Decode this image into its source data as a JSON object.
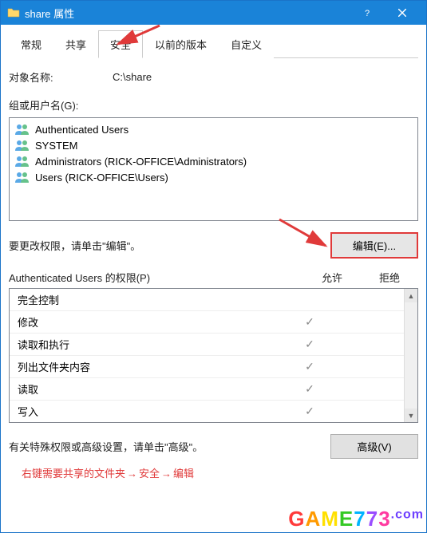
{
  "titlebar": {
    "title": "share 属性"
  },
  "tabs": [
    {
      "label": "常规",
      "active": false
    },
    {
      "label": "共享",
      "active": false
    },
    {
      "label": "安全",
      "active": true
    },
    {
      "label": "以前的版本",
      "active": false
    },
    {
      "label": "自定义",
      "active": false
    }
  ],
  "object": {
    "label": "对象名称:",
    "value": "C:\\share"
  },
  "groups": {
    "label": "组或用户名(G):",
    "items": [
      "Authenticated Users",
      "SYSTEM",
      "Administrators (RICK-OFFICE\\Administrators)",
      "Users (RICK-OFFICE\\Users)"
    ]
  },
  "edit": {
    "text": "要更改权限，请单击\"编辑\"。",
    "button": "编辑(E)..."
  },
  "permissions": {
    "header_name_prefix": "Authenticated Users",
    "header_name_suffix": " 的权限(P)",
    "col_allow": "允许",
    "col_deny": "拒绝",
    "rows": [
      {
        "name": "完全控制",
        "allow": false,
        "deny": false
      },
      {
        "name": "修改",
        "allow": true,
        "deny": false
      },
      {
        "name": "读取和执行",
        "allow": true,
        "deny": false
      },
      {
        "name": "列出文件夹内容",
        "allow": true,
        "deny": false
      },
      {
        "name": "读取",
        "allow": true,
        "deny": false
      },
      {
        "name": "写入",
        "allow": true,
        "deny": false
      }
    ]
  },
  "advanced": {
    "text": "有关特殊权限或高级设置，请单击\"高级\"。",
    "button": "高级(V)"
  },
  "footnote": {
    "p1": "右键需要共享的文件夹",
    "p2": "安全",
    "p3": "编辑"
  },
  "watermark": "GAME773.com"
}
